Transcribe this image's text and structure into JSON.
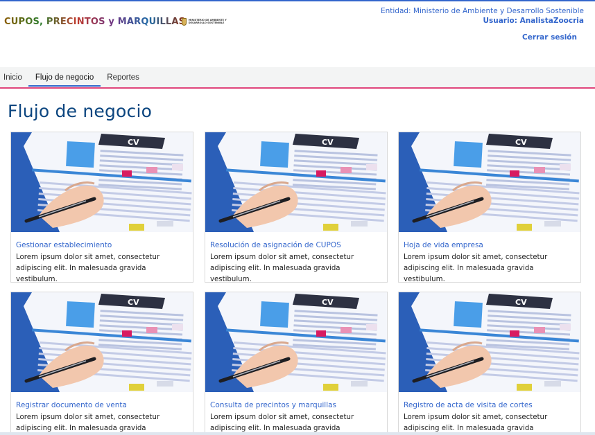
{
  "header": {
    "app_logo_text": "CUPOS, PRECINTOS y MARQUILLAS",
    "ministry_logo_text": "MINISTERIO DE AMBIENTE Y DESARROLLO SOSTENIBLE",
    "entity_text": "Entidad: Ministerio de Ambiente y Desarrollo Sostenible",
    "user_text": "Usuario: AnalistaZoocria",
    "logout_label": "Cerrar sesión"
  },
  "nav": {
    "items": [
      {
        "label": "Inicio",
        "active": false
      },
      {
        "label": "Flujo de negocio",
        "active": true
      },
      {
        "label": "Reportes",
        "active": false
      }
    ]
  },
  "main": {
    "title": "Flujo de negocio",
    "cards": [
      {
        "title": "Gestionar establecimiento",
        "description": "Lorem ipsum dolor sit amet, consectetur adipiscing elit. In malesuada gravida vestibulum.",
        "image_label": "CV"
      },
      {
        "title": "Resolución de asignación de CUPOS",
        "description": "Lorem ipsum dolor sit amet, consectetur adipiscing elit. In malesuada gravida vestibulum.",
        "image_label": "CV"
      },
      {
        "title": "Hoja de vida empresa",
        "description": "Lorem ipsum dolor sit amet, consectetur adipiscing elit. In malesuada gravida vestibulum.",
        "image_label": "CV"
      },
      {
        "title": "Registrar documento de venta",
        "description": "Lorem ipsum dolor sit amet, consectetur adipiscing elit. In malesuada gravida vestibulum.",
        "image_label": "CV"
      },
      {
        "title": "Consulta de precintos y marquillas",
        "description": "Lorem ipsum dolor sit amet, consectetur adipiscing elit. In malesuada gravida vestibulum.",
        "image_label": "CV"
      },
      {
        "title": "Registro de acta de visita de cortes",
        "description": "Lorem ipsum dolor sit amet, consectetur adipiscing elit. In malesuada gravida vestibulum.",
        "image_label": "CV"
      }
    ]
  },
  "colors": {
    "accent": "#3366cc",
    "title": "#0b457f",
    "nav_underline": "#e0457b"
  },
  "icons": {
    "card_image": "cv-document-with-pen-image"
  }
}
